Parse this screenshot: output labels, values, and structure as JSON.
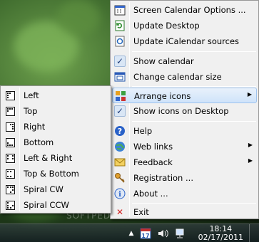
{
  "main_menu": {
    "items": [
      {
        "label": "Screen Calendar Options ...",
        "icon": "calendar-options-icon"
      },
      {
        "label": "Update Desktop",
        "icon": "refresh-icon"
      },
      {
        "label": "Update iCalendar sources",
        "icon": "sync-icon"
      },
      {
        "label": "Show calendar",
        "icon": "check-icon",
        "checked": true
      },
      {
        "label": "Change calendar size",
        "icon": "resize-icon"
      },
      {
        "label": "Arrange icons",
        "icon": "arrange-icon",
        "submenu": true,
        "highlighted": true
      },
      {
        "label": "Show icons on Desktop",
        "icon": "check-icon",
        "checked": true
      },
      {
        "label": "Help",
        "icon": "help-icon"
      },
      {
        "label": "Web links",
        "icon": "globe-icon",
        "submenu": true
      },
      {
        "label": "Feedback",
        "icon": "envelope-icon",
        "submenu": true
      },
      {
        "label": "Registration ...",
        "icon": "key-icon"
      },
      {
        "label": "About ...",
        "icon": "info-icon"
      },
      {
        "label": "Exit",
        "icon": "close-icon"
      }
    ]
  },
  "arrange_submenu": {
    "items": [
      {
        "label": "Left"
      },
      {
        "label": "Top"
      },
      {
        "label": "Right"
      },
      {
        "label": "Bottom"
      },
      {
        "label": "Left & Right"
      },
      {
        "label": "Top & Bottom"
      },
      {
        "label": "Spiral CW"
      },
      {
        "label": "Spiral CCW"
      }
    ]
  },
  "taskbar": {
    "time": "18:14",
    "date": "02/17/2011",
    "tray_badge": "17"
  },
  "watermark": "SOFTPEDIA",
  "watermark_url": "www.softpedia.com",
  "colors": {
    "highlight": "#cfe3fa",
    "menu_bg": "#f0f0f0",
    "exit_red": "#d22020"
  }
}
